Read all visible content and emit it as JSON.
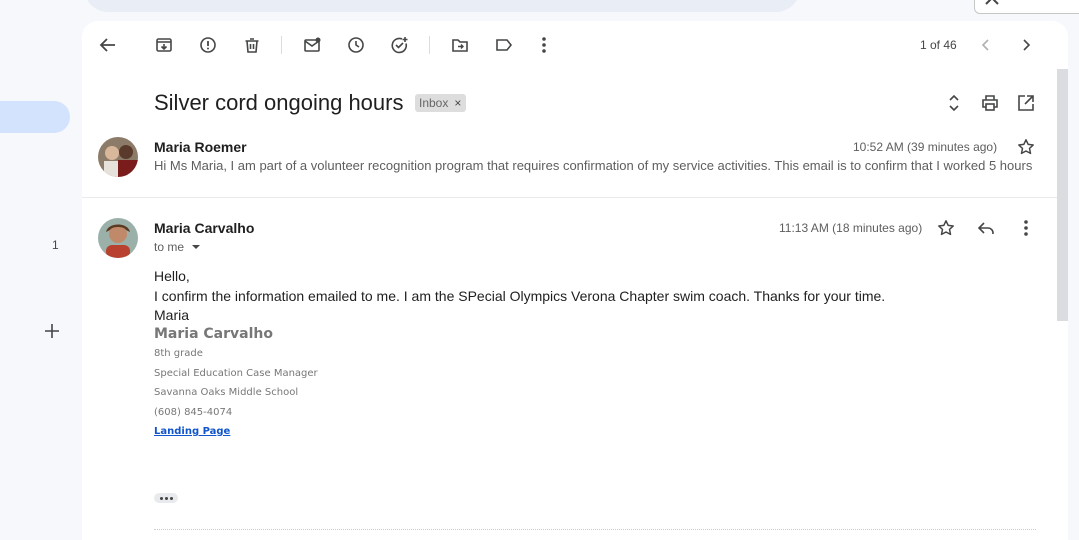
{
  "left_rail": {
    "count": "1"
  },
  "toolbar": {
    "pager": "1 of 46",
    "icons": [
      "back-arrow-icon",
      "archive-icon",
      "report-spam-icon",
      "delete-icon",
      "mark-unread-icon",
      "snooze-icon",
      "add-task-icon",
      "move-to-icon",
      "label-icon",
      "more-vert-icon",
      "chevron-left-icon",
      "chevron-right-icon"
    ]
  },
  "thread": {
    "subject": "Silver cord ongoing hours",
    "label": "Inbox",
    "label_remove": "×"
  },
  "messages": [
    {
      "sender": "Maria Roemer",
      "time": "10:52 AM (39 minutes ago)",
      "snippet": "Hi Ms Maria, I am part of a volunteer recognition program that requires confirmation of my service activities. This email is to confirm that I worked 5 hours"
    },
    {
      "sender": "Maria Carvalho",
      "time": "11:13 AM (18 minutes ago)",
      "to": "to me",
      "body": [
        "Hello,",
        "I confirm the information emailed to me. I am the SPecial Olympics Verona Chapter swim coach. Thanks for your time.",
        "Maria"
      ],
      "signature": {
        "name": "Maria Carvalho",
        "lines": [
          "8th grade",
          "Special Education Case Manager",
          "Savanna Oaks Middle School",
          "(608) 845-4074"
        ],
        "link": "Landing Page"
      }
    }
  ],
  "colors": {
    "accent_pill": "#d3e3fd",
    "link": "#1155cc",
    "card": "#ffffff",
    "background": "#f6f8fc"
  }
}
